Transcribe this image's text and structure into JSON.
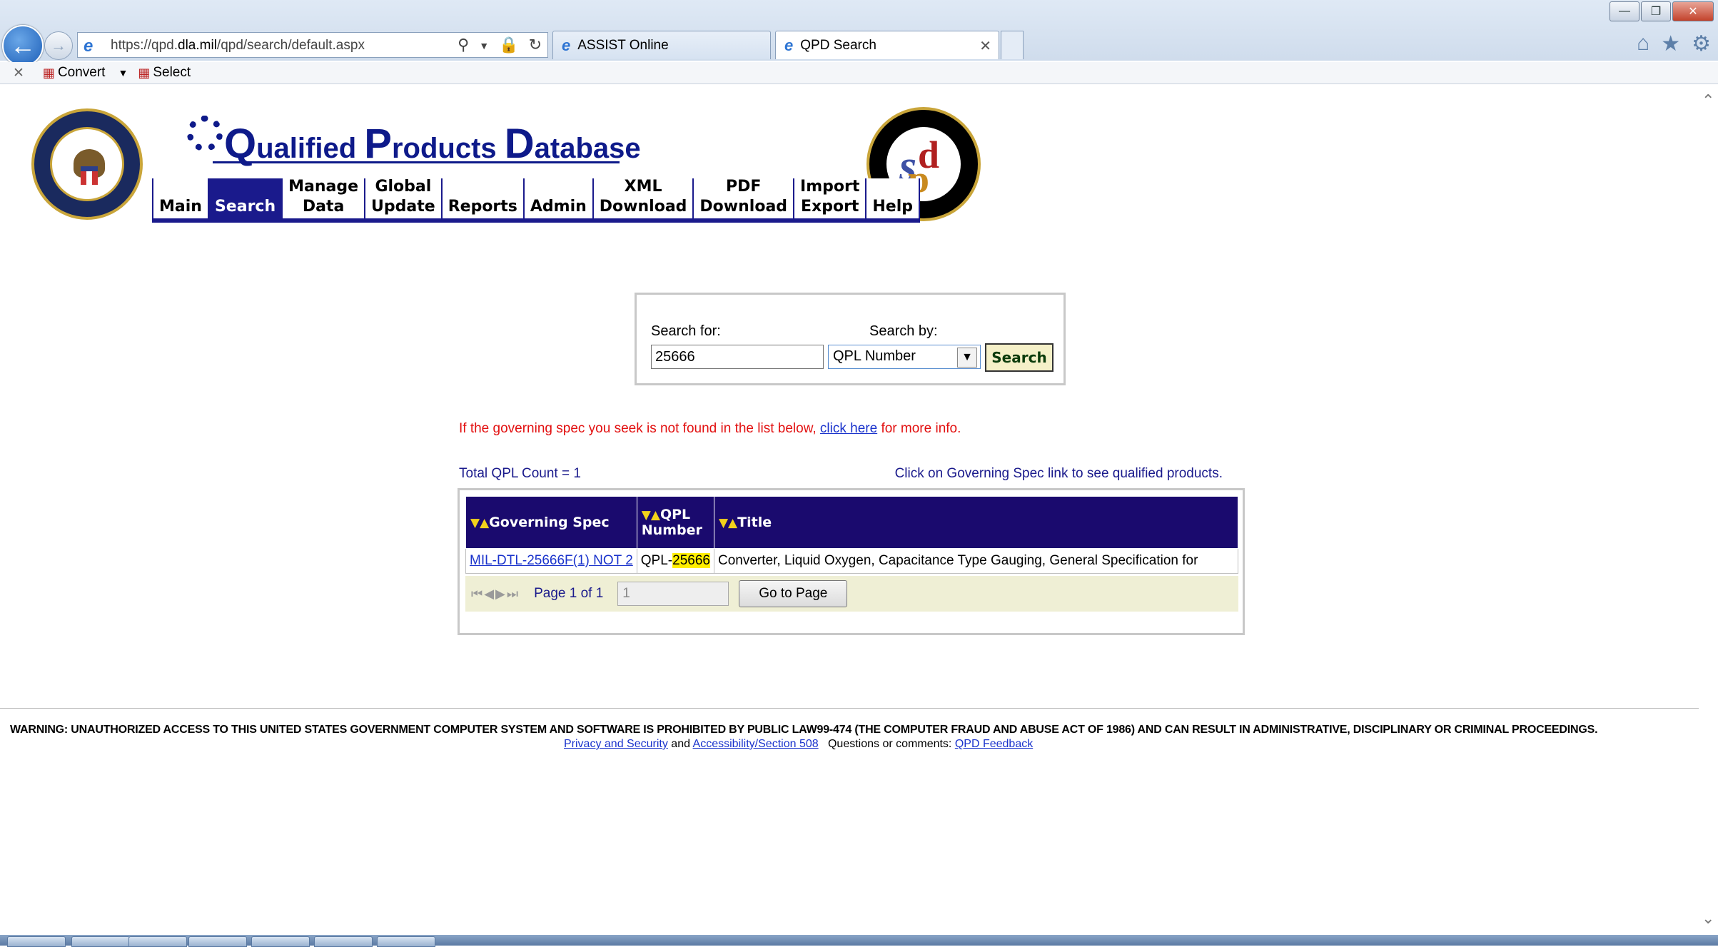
{
  "browser": {
    "url_prefix": "https://qpd.",
    "url_domain": "dla.mil",
    "url_path": "/qpd/search/default.aspx",
    "tabs": [
      {
        "label": "ASSIST Online"
      },
      {
        "label": "QPD Search"
      }
    ],
    "command_bar": {
      "convert_label": "Convert",
      "select_label": "Select"
    }
  },
  "header": {
    "logo_text_q": "Q",
    "logo_text_1": "ualified ",
    "logo_text_p": "P",
    "logo_text_2": "roducts ",
    "logo_text_d": "D",
    "logo_text_3": "atabase",
    "dsp_letters": {
      "d": "d",
      "s": "s",
      "p": "p"
    }
  },
  "menu": {
    "items": [
      {
        "line1": "",
        "line2": "Main"
      },
      {
        "line1": "",
        "line2": "Search"
      },
      {
        "line1": "Manage",
        "line2": "Data"
      },
      {
        "line1": "Global",
        "line2": "Update"
      },
      {
        "line1": "",
        "line2": "Reports"
      },
      {
        "line1": "",
        "line2": "Admin"
      },
      {
        "line1": "XML",
        "line2": "Download"
      },
      {
        "line1": "PDF",
        "line2": "Download"
      },
      {
        "line1": "Import",
        "line2": "Export"
      },
      {
        "line1": "",
        "line2": "Help"
      }
    ],
    "selected": "Search"
  },
  "search": {
    "for_label": "Search for:",
    "by_label": "Search by:",
    "query_value": "25666",
    "by_value": "QPL Number",
    "button_label": "Search"
  },
  "notice": {
    "text_before": "If the governing spec you seek is not found in the list below, ",
    "link_text": "click here",
    "text_after": " for more info."
  },
  "results": {
    "count_text": "Total QPL Count = 1",
    "hint_text": "Click on Governing Spec link to see qualified products.",
    "columns": [
      {
        "label": "Governing Spec"
      },
      {
        "label_line1": "QPL",
        "label_line2": "Number"
      },
      {
        "label": "Title"
      }
    ],
    "sort_arrows": "▼▲",
    "rows": [
      {
        "governing_spec": "MIL-DTL-25666F(1) NOT 2",
        "qpl_prefix": "QPL-",
        "qpl_highlight": "25666",
        "title": "Converter, Liquid Oxygen, Capacitance Type Gauging, General Specification for"
      }
    ],
    "pager": {
      "page_text": "Page 1 of 1",
      "page_input": "1",
      "go_label": "Go to Page"
    }
  },
  "footer": {
    "warning": "WARNING: UNAUTHORIZED ACCESS TO THIS UNITED STATES GOVERNMENT COMPUTER SYSTEM AND SOFTWARE IS PROHIBITED BY PUBLIC LAW99-474 (THE COMPUTER FRAUD AND ABUSE ACT OF 1986) AND CAN RESULT IN ADMINISTRATIVE, DISCIPLINARY OR CRIMINAL PROCEEDINGS.",
    "privacy_link": "Privacy and Security",
    "and_text": " and ",
    "accessibility_link": "Accessibility/Section 508",
    "questions_text": "   Questions or comments: ",
    "feedback_link": "QPD Feedback"
  }
}
